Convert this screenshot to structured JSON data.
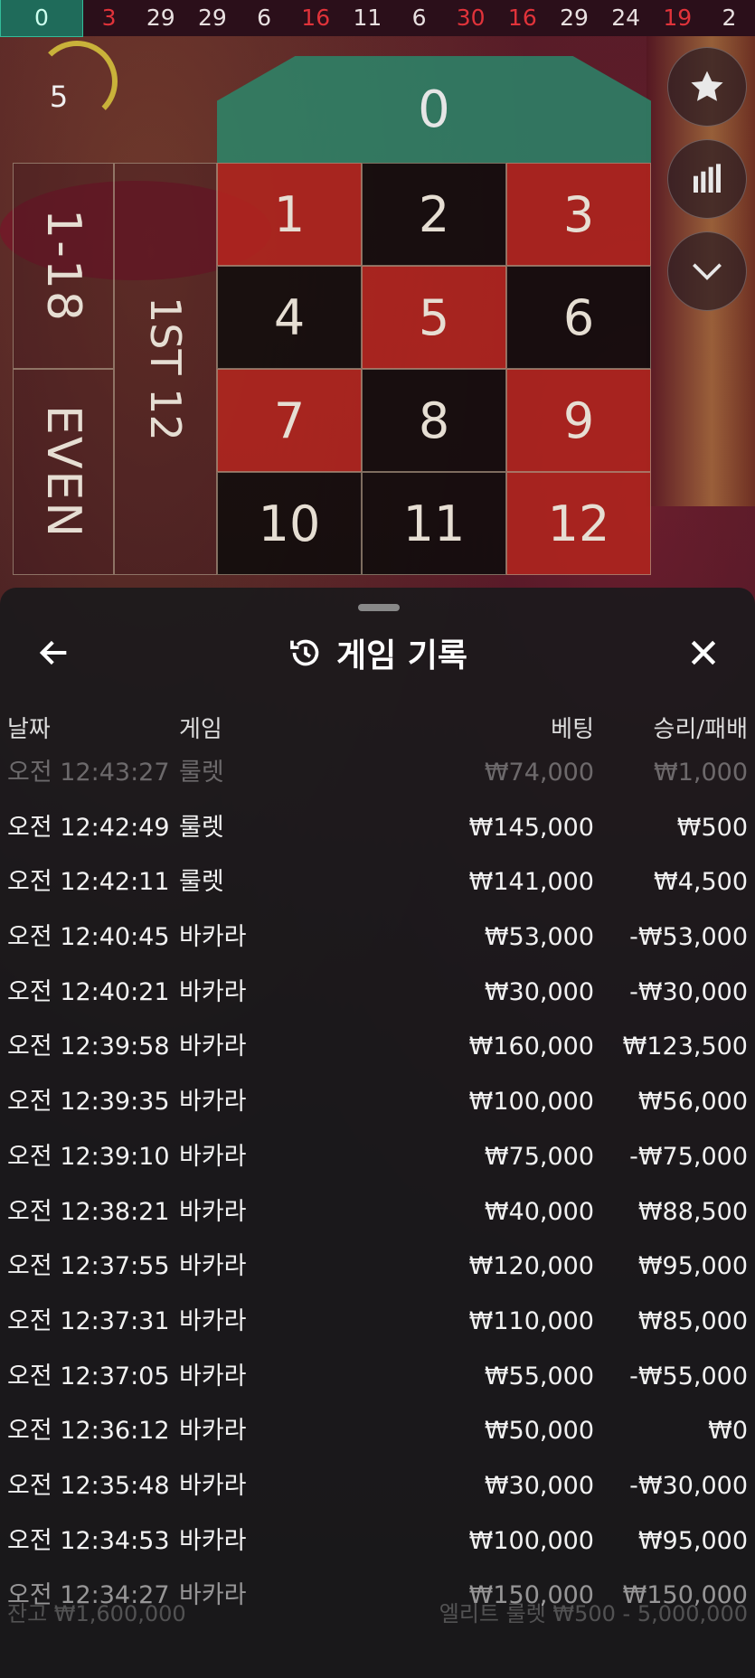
{
  "strip": {
    "numbers": [
      {
        "v": "0",
        "c": "green"
      },
      {
        "v": "3",
        "c": "red"
      },
      {
        "v": "29",
        "c": "black"
      },
      {
        "v": "29",
        "c": "black"
      },
      {
        "v": "6",
        "c": "black"
      },
      {
        "v": "16",
        "c": "red"
      },
      {
        "v": "11",
        "c": "black"
      },
      {
        "v": "6",
        "c": "black"
      },
      {
        "v": "30",
        "c": "red"
      },
      {
        "v": "16",
        "c": "red"
      },
      {
        "v": "29",
        "c": "black"
      },
      {
        "v": "24",
        "c": "black"
      },
      {
        "v": "19",
        "c": "red"
      },
      {
        "v": "2",
        "c": "black"
      }
    ]
  },
  "timer": {
    "value": "5"
  },
  "board": {
    "zero": "0",
    "cells": [
      {
        "n": "1",
        "c": "red"
      },
      {
        "n": "2",
        "c": "black"
      },
      {
        "n": "3",
        "c": "red"
      },
      {
        "n": "4",
        "c": "black"
      },
      {
        "n": "5",
        "c": "red"
      },
      {
        "n": "6",
        "c": "black"
      },
      {
        "n": "7",
        "c": "red"
      },
      {
        "n": "8",
        "c": "black"
      },
      {
        "n": "9",
        "c": "red"
      },
      {
        "n": "10",
        "c": "black"
      },
      {
        "n": "11",
        "c": "black"
      },
      {
        "n": "12",
        "c": "red"
      }
    ],
    "low_bet": "1-18",
    "even_bet": "EVEN",
    "dozen_bet": "1ST 12"
  },
  "side_buttons": [
    "star-icon",
    "stats-icon",
    "chevron-down-icon"
  ],
  "history": {
    "title": "게임 기록",
    "columns": {
      "date": "날짜",
      "game": "게임",
      "bet": "베팅",
      "win": "승리/패배"
    },
    "rows": [
      {
        "date": "오전 12:43:27",
        "game": "룰렛",
        "bet": "₩74,000",
        "win": "₩1,000"
      },
      {
        "date": "오전 12:42:49",
        "game": "룰렛",
        "bet": "₩145,000",
        "win": "₩500"
      },
      {
        "date": "오전 12:42:11",
        "game": "룰렛",
        "bet": "₩141,000",
        "win": "₩4,500"
      },
      {
        "date": "오전 12:40:45",
        "game": "바카라",
        "bet": "₩53,000",
        "win": "-₩53,000"
      },
      {
        "date": "오전 12:40:21",
        "game": "바카라",
        "bet": "₩30,000",
        "win": "-₩30,000"
      },
      {
        "date": "오전 12:39:58",
        "game": "바카라",
        "bet": "₩160,000",
        "win": "₩123,500"
      },
      {
        "date": "오전 12:39:35",
        "game": "바카라",
        "bet": "₩100,000",
        "win": "₩56,000"
      },
      {
        "date": "오전 12:39:10",
        "game": "바카라",
        "bet": "₩75,000",
        "win": "-₩75,000"
      },
      {
        "date": "오전 12:38:21",
        "game": "바카라",
        "bet": "₩40,000",
        "win": "₩88,500"
      },
      {
        "date": "오전 12:37:55",
        "game": "바카라",
        "bet": "₩120,000",
        "win": "₩95,000"
      },
      {
        "date": "오전 12:37:31",
        "game": "바카라",
        "bet": "₩110,000",
        "win": "₩85,000"
      },
      {
        "date": "오전 12:37:05",
        "game": "바카라",
        "bet": "₩55,000",
        "win": "-₩55,000"
      },
      {
        "date": "오전 12:36:12",
        "game": "바카라",
        "bet": "₩50,000",
        "win": "₩0"
      },
      {
        "date": "오전 12:35:48",
        "game": "바카라",
        "bet": "₩30,000",
        "win": "-₩30,000"
      },
      {
        "date": "오전 12:34:53",
        "game": "바카라",
        "bet": "₩100,000",
        "win": "₩95,000"
      },
      {
        "date": "오전 12:34:27",
        "game": "바카라",
        "bet": "₩150,000",
        "win": "₩150,000"
      }
    ]
  },
  "footer": {
    "balance": "잔고 ₩1,600,000",
    "limits": "엘리트 룰렛 ₩500 - 5,000,000"
  }
}
